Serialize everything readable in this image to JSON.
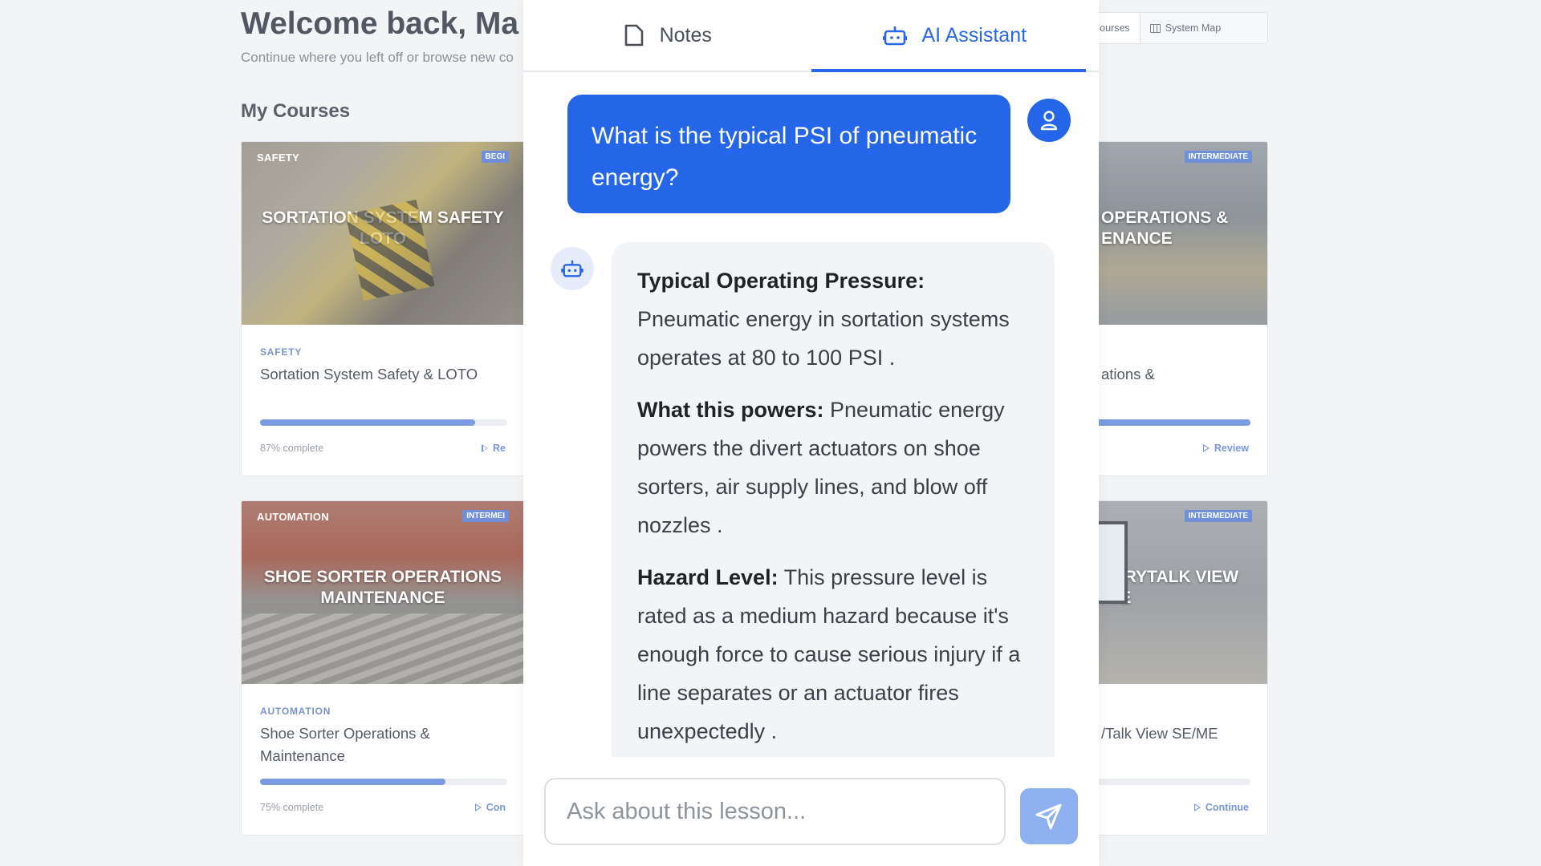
{
  "header": {
    "welcome": "Welcome back, Ma",
    "subtitle": "Continue where you left off or browse new co",
    "section": "My Courses",
    "tabs": [
      {
        "label": "My Courses"
      },
      {
        "label": "System Map"
      }
    ]
  },
  "cards": [
    {
      "img_category": "SAFETY",
      "level": "BEGI",
      "big_title": "SORTATION SYSTEM SAFETY LOTO",
      "category": "SAFETY",
      "title": "Sortation System Safety & LOTO",
      "progress_fraction": 0.87,
      "meta": "87% complete",
      "action": "Re"
    },
    {
      "img_category": "",
      "level": "INTERMEDIATE",
      "big_title": "OPERATIONS & ENANCE",
      "category": "",
      "title": "ations &",
      "progress_fraction": 1.0,
      "meta": "",
      "action": "Review"
    },
    {
      "img_category": "AUTOMATION",
      "level": "INTERMEI",
      "big_title": "SHOE SORTER OPERATIONS MAINTENANCE",
      "category": "AUTOMATION",
      "title": "Shoe Sorter Operations & Maintenance",
      "progress_fraction": 0.75,
      "meta": "75% complete",
      "action": "Con"
    },
    {
      "img_category": "",
      "level": "INTERMEDIATE",
      "big_title": "TORYTALK VIEW /ME",
      "category": "",
      "title": "/Talk View SE/ME",
      "progress_fraction": 0.0,
      "meta": "",
      "action": "Continue"
    }
  ],
  "panel": {
    "tabs": [
      {
        "label": "Notes",
        "icon": "document-icon"
      },
      {
        "label": "AI Assistant",
        "icon": "robot-icon"
      }
    ],
    "active_tab": "AI Assistant",
    "user_message": "What is the typical PSI of pneumatic energy?",
    "bot": {
      "p1_label": "Typical Operating Pressure:",
      "p1_text": "Pneumatic energy in sortation systems operates at 80 to 100 PSI .",
      "p2_label": "What this powers:",
      "p2_text": "Pneumatic energy powers the divert actuators on shoe sorters, air supply lines, and blow off nozzles .",
      "p3_label": "Hazard Level:",
      "p3_text": "This pressure level is rated as a medium hazard because it's enough force to cause serious injury if a line separates or an actuator fires unexpectedly ."
    },
    "input_placeholder": "Ask about this lesson...",
    "accent": "#2566e8"
  }
}
